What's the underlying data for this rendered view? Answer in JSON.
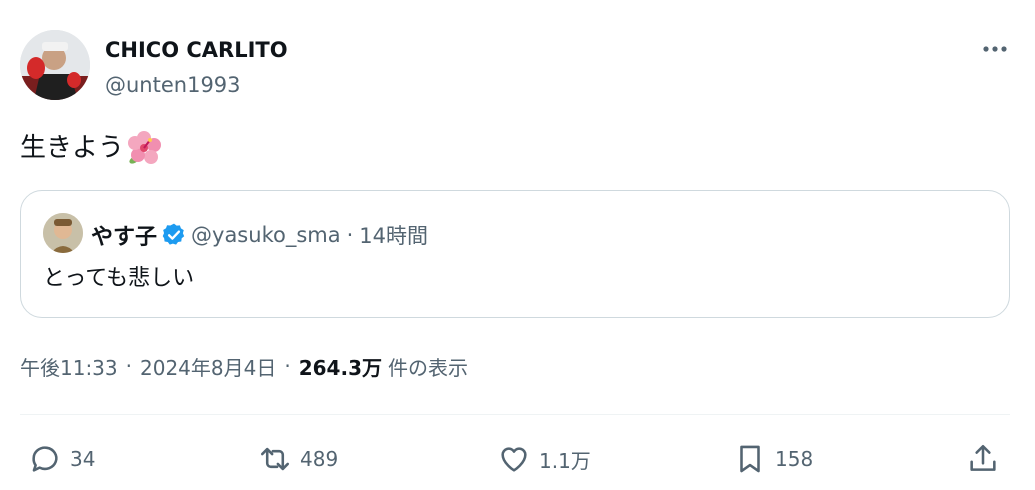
{
  "author": {
    "display_name": "CHICO CARLITO",
    "handle": "@unten1993",
    "avatar": "profile-photo"
  },
  "more_menu": {
    "icon": "more-horizontal-icon"
  },
  "tweet": {
    "text": "生きよう",
    "emoji": "hibiscus-emoji"
  },
  "quote": {
    "display_name": "やす子",
    "verified": true,
    "verified_icon": "verified-badge-icon",
    "handle": "@yasuko_sma",
    "separator": "·",
    "time": "14時間",
    "text": "とっても悲しい"
  },
  "meta": {
    "time": "午後11:33",
    "sep1": "·",
    "date": "2024年8月4日",
    "sep2": "·",
    "views_count": "264.3万",
    "views_label": "件の表示"
  },
  "actions": {
    "reply": {
      "icon": "reply-icon",
      "count": "34"
    },
    "retweet": {
      "icon": "retweet-icon",
      "count": "489"
    },
    "like": {
      "icon": "heart-icon",
      "count": "1.1万"
    },
    "bookmark": {
      "icon": "bookmark-icon",
      "count": "158"
    },
    "share": {
      "icon": "share-icon"
    }
  },
  "colors": {
    "text_primary": "#0f1419",
    "text_secondary": "#536471",
    "border": "#cfd9de",
    "verified_blue": "#1d9bf0"
  }
}
